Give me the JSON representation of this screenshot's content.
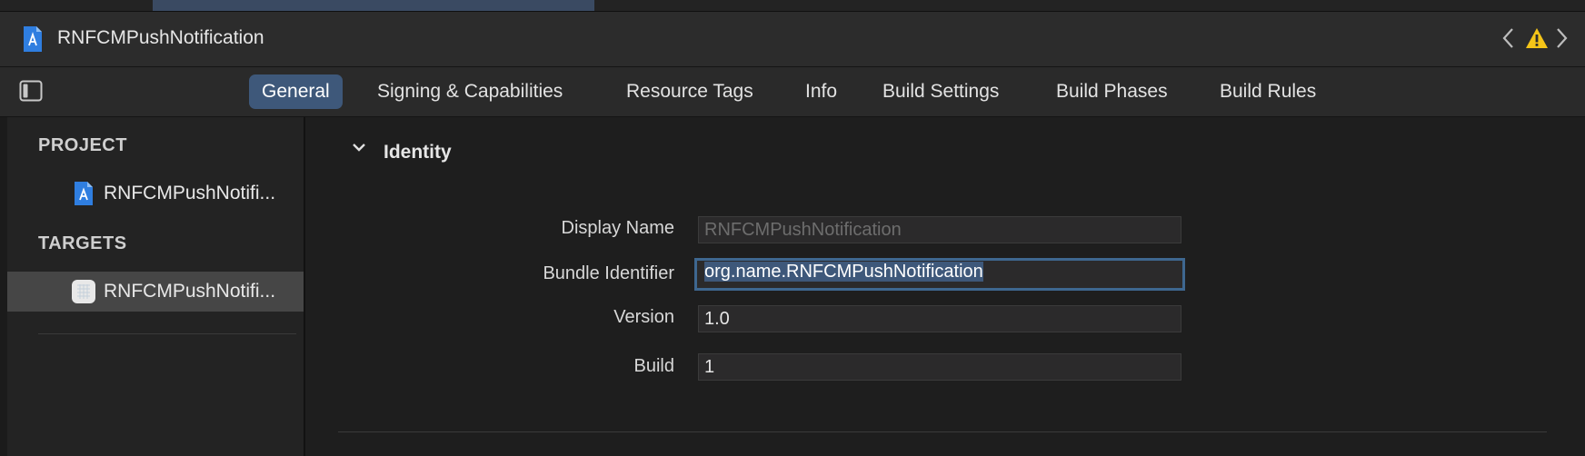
{
  "window": {
    "title": "RNFCMPushNotification"
  },
  "tabs": [
    {
      "label": "General",
      "active": true
    },
    {
      "label": "Signing & Capabilities",
      "active": false
    },
    {
      "label": "Resource Tags",
      "active": false
    },
    {
      "label": "Info",
      "active": false
    },
    {
      "label": "Build Settings",
      "active": false
    },
    {
      "label": "Build Phases",
      "active": false
    },
    {
      "label": "Build Rules",
      "active": false
    }
  ],
  "sidebar": {
    "project_header": "PROJECT",
    "project_item": "RNFCMPushNotifi...",
    "targets_header": "TARGETS",
    "target_item": "RNFCMPushNotifi..."
  },
  "identity": {
    "section_title": "Identity",
    "fields": [
      {
        "label": "Display Name",
        "value": "",
        "placeholder": "RNFCMPushNotification"
      },
      {
        "label": "Bundle Identifier",
        "value": "org.name.RNFCMPushNotification"
      },
      {
        "label": "Version",
        "value": "1.0"
      },
      {
        "label": "Build",
        "value": "1"
      }
    ]
  },
  "icons": {
    "document": "xcode-project-icon",
    "target": "app-target-icon",
    "warning": "warning-icon",
    "back": "chevron-left-icon",
    "forward": "chevron-right-icon",
    "sidebar_toggle": "sidebar-toggle-icon",
    "disclosure": "chevron-down-icon"
  },
  "colors": {
    "accent": "#3e587a",
    "focus_ring": "#3e6790",
    "warning": "#f5c518",
    "project_icon": "#2f7ee0"
  }
}
